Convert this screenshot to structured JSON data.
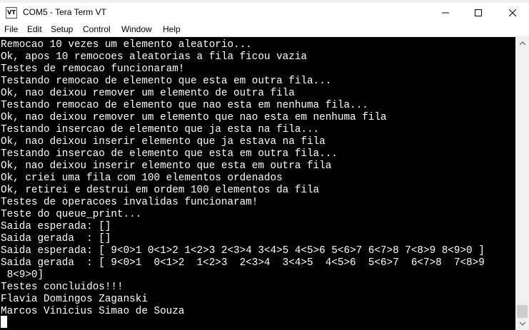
{
  "window": {
    "title": "COM5 - Tera Term VT",
    "icon_text": "VT"
  },
  "menu": [
    "File",
    "Edit",
    "Setup",
    "Control",
    "Window",
    "Help"
  ],
  "terminal_lines": [
    "Remocao 10 vezes um elemento aleatorio...",
    "Ok, apos 10 remocoes aleatorias a fila ficou vazia",
    "Testes de remocao funcionaram!",
    "Testando remocao de elemento que esta em outra fila...",
    "Ok, nao deixou remover um elemento de outra fila",
    "Testando remocao de elemento que nao esta em nenhuma fila...",
    "Ok, nao deixou remover um elemento que nao esta em nenhuma fila",
    "Testando insercao de elemento que ja esta na fila...",
    "Ok, nao deixou inserir elemento que ja estava na fila",
    "Testando insercao de elemento que esta em outra fila...",
    "Ok, nao deixou inserir elemento que esta em outra fila",
    "Ok, criei uma fila com 100 elementos ordenados",
    "Ok, retirei e destrui em ordem 100 elementos da fila",
    "Testes de operacoes invalidas funcionaram!",
    "Teste do queue_print...",
    "Saida esperada: []",
    "Saida gerada  : []",
    "Saida esperada: [ 9<0>1 0<1>2 1<2>3 2<3>4 3<4>5 4<5>6 5<6>7 6<7>8 7<8>9 8<9>0 ]",
    "Saida gerada  : [ 9<0>1  0<1>2  1<2>3  2<3>4  3<4>5  4<5>6  5<6>7  6<7>8  7<8>9",
    " 8<9>0]",
    "Testes concluidos!!!",
    "Flavia Domingos Zaganski",
    "Marcos Vinicius Simao de Souza"
  ]
}
